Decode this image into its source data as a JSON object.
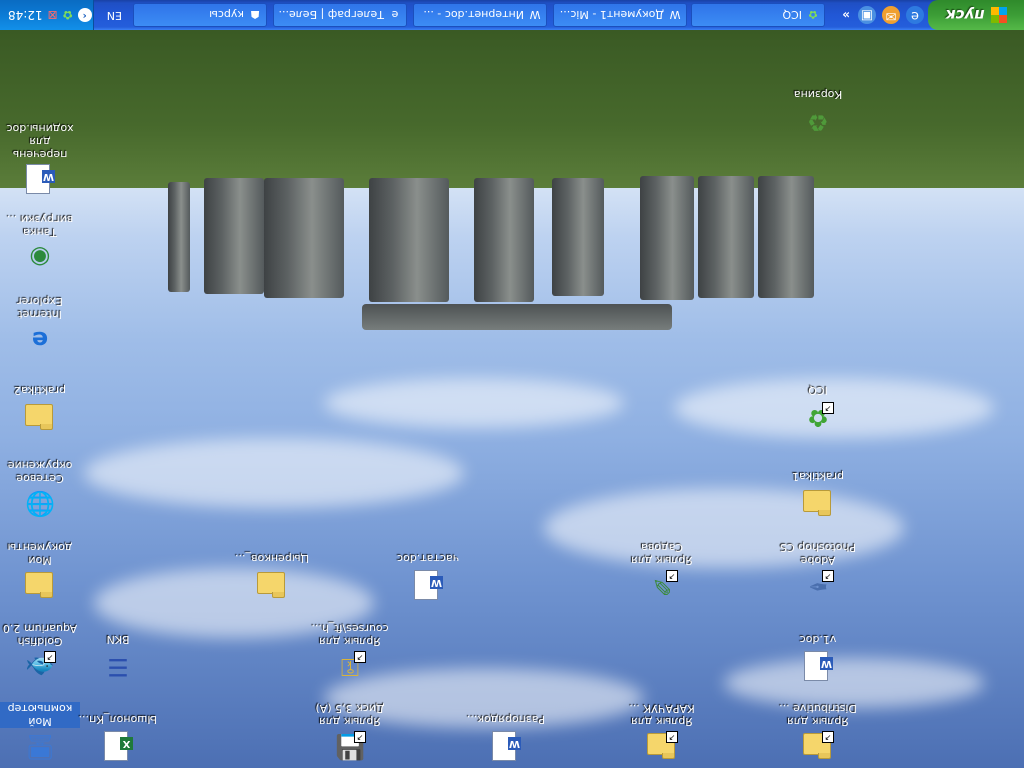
{
  "desktop": {
    "icons": [
      {
        "name": "my-computer",
        "label": "Мой компьютер",
        "icon": "computer-icon",
        "selected": true
      },
      {
        "name": "word-doc-1",
        "label": "Ышонол_Кп...",
        "icon": "excel-doc-icon"
      },
      {
        "name": "shortcut-disk",
        "label": "Ярлык для Диск 3,5 (A)",
        "icon": "floppy-icon"
      },
      {
        "name": "word-doc-2",
        "label": "Разпорядок...",
        "icon": "word-doc-icon"
      },
      {
        "name": "shortcut-kapakuk",
        "label": "Ярлык для КАРАЧУК ...",
        "icon": "folder-shortcut-icon"
      },
      {
        "name": "shortcut-distributive",
        "label": "Ярлык для Distributive ...",
        "icon": "folder-shortcut-icon"
      },
      {
        "name": "goldfish",
        "label": "Goldfish Aquarium 2.0",
        "icon": "fish-icon"
      },
      {
        "name": "bkn",
        "label": "BKN",
        "icon": "text-icon"
      },
      {
        "name": "shortcut-coursesft",
        "label": "Ярлык для courses\\ft_h...",
        "icon": "key-icon"
      },
      {
        "name": "word-v1",
        "label": "v1.doc",
        "icon": "word-doc-icon"
      },
      {
        "name": "my-documents",
        "label": "Мои документы",
        "icon": "documents-folder-icon"
      },
      {
        "name": "folder-tsirenkov",
        "label": "Цыренков_...",
        "icon": "folder-icon"
      },
      {
        "name": "word-vastat",
        "label": "частат.doc",
        "icon": "word-doc-icon"
      },
      {
        "name": "shortcut-sadova",
        "label": "Ярлык для Садова",
        "icon": "pen-icon"
      },
      {
        "name": "photoshop",
        "label": "Adobe Photoshop CS",
        "icon": "feather-icon"
      },
      {
        "name": "network",
        "label": "Сетевое окружение",
        "icon": "network-icon"
      },
      {
        "name": "folder-praktika1",
        "label": "praktika1",
        "icon": "folder-icon"
      },
      {
        "name": "folder-praktika2",
        "label": "praktika2",
        "icon": "folder-icon"
      },
      {
        "name": "icq",
        "label": "ICQ",
        "icon": "flower-icon"
      },
      {
        "name": "ie",
        "label": "Internet Explorer",
        "icon": "ie-icon"
      },
      {
        "name": "tanka",
        "label": "Танка вигрузки ...",
        "icon": "globe-icon"
      },
      {
        "name": "word-perechen",
        "label": "перечень для ходины.doc",
        "icon": "word-doc-icon"
      },
      {
        "name": "recycle",
        "label": "Корзина",
        "icon": "recycle-bin-icon"
      }
    ]
  },
  "taskbar": {
    "start_label": "пуск",
    "quick_more": "»",
    "tasks": [
      {
        "label": "ICQ",
        "icon": "flower-icon"
      },
      {
        "label": "Документ1 - Mic...",
        "icon": "word-icon"
      },
      {
        "label": "Интернет.doc - ...",
        "icon": "word-icon"
      },
      {
        "label": "Телеграф | Беле...",
        "icon": "ie-icon"
      },
      {
        "label": "курсы",
        "icon": "folder-icon"
      }
    ],
    "language": "EN",
    "clock": "12:48"
  }
}
